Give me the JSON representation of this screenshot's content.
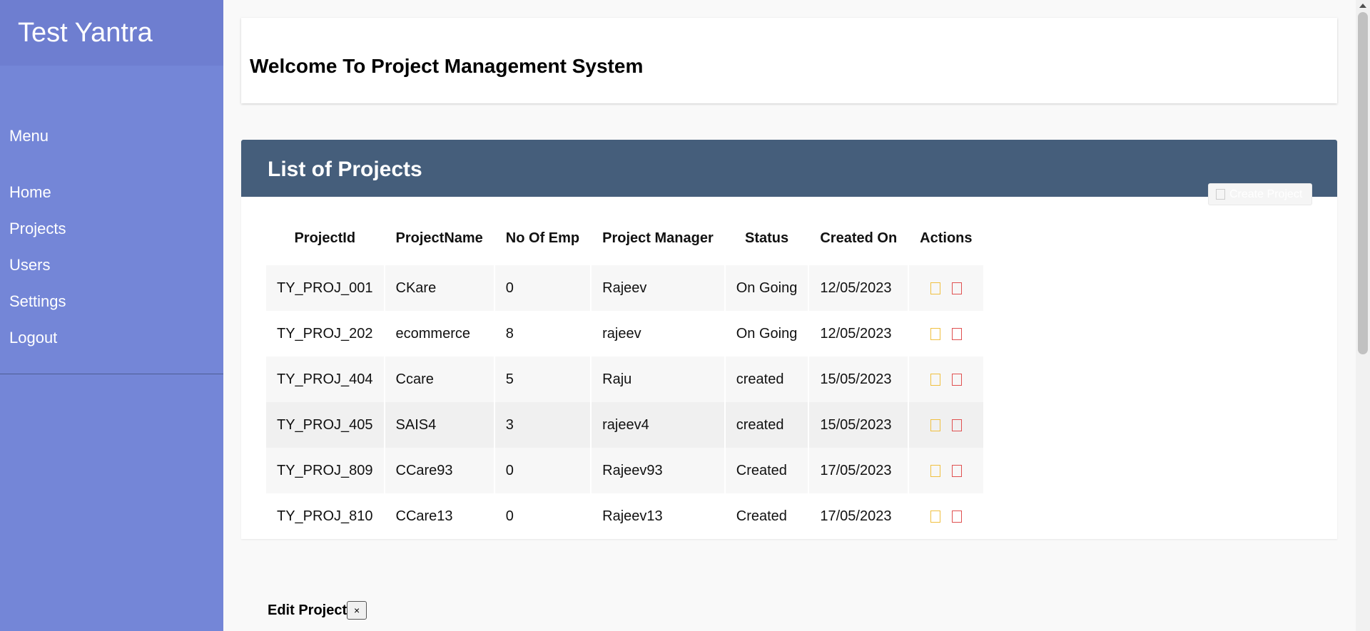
{
  "sidebar": {
    "brand": "Test Yantra",
    "menu_label": "Menu",
    "items": [
      {
        "label": "Home"
      },
      {
        "label": "Projects"
      },
      {
        "label": "Users"
      },
      {
        "label": "Settings"
      },
      {
        "label": "Logout"
      }
    ]
  },
  "header": {
    "title": "Welcome To Project Management System"
  },
  "projects": {
    "title": "List of Projects",
    "create_label": "Create Project",
    "columns": [
      "ProjectId",
      "ProjectName",
      "No Of Emp",
      "Project Manager",
      "Status",
      "Created On",
      "Actions"
    ],
    "rows": [
      {
        "id": "TY_PROJ_001",
        "name": "CKare",
        "emp": "0",
        "manager": "Rajeev",
        "status": "On Going",
        "created": "12/05/2023"
      },
      {
        "id": "TY_PROJ_202",
        "name": "ecommerce",
        "emp": "8",
        "manager": "rajeev",
        "status": "On Going",
        "created": "12/05/2023"
      },
      {
        "id": "TY_PROJ_404",
        "name": "Ccare",
        "emp": "5",
        "manager": "Raju",
        "status": "created",
        "created": "15/05/2023"
      },
      {
        "id": "TY_PROJ_405",
        "name": "SAIS4",
        "emp": "3",
        "manager": "rajeev4",
        "status": "created",
        "created": "15/05/2023"
      },
      {
        "id": "TY_PROJ_809",
        "name": "CCare93",
        "emp": "0",
        "manager": "Rajeev93",
        "status": "Created",
        "created": "17/05/2023"
      },
      {
        "id": "TY_PROJ_810",
        "name": "CCare13",
        "emp": "0",
        "manager": "Rajeev13",
        "status": "Created",
        "created": "17/05/2023"
      }
    ]
  },
  "edit_modal": {
    "title": "Edit Project",
    "close_label": "×"
  },
  "colors": {
    "sidebar": "#7486d7",
    "brand_bar": "#6e7ed0",
    "card_header": "#455e7b",
    "edit_icon": "#f0c040",
    "delete_icon": "#e05050"
  }
}
